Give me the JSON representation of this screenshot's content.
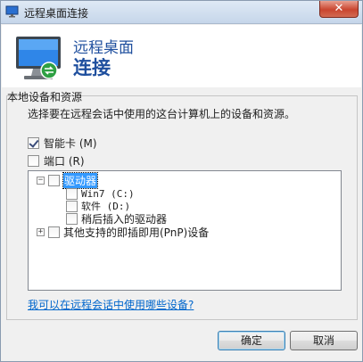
{
  "window": {
    "title": "远程桌面连接",
    "close_label": "✕"
  },
  "header": {
    "line1": "远程桌面",
    "line2": "连接"
  },
  "group": {
    "label": "本地设备和资源",
    "description": "选择要在远程会话中使用的这台计算机上的设备和资源。"
  },
  "options": [
    {
      "label": "智能卡 (M)",
      "checked": true
    },
    {
      "label": "端口 (R)",
      "checked": false
    }
  ],
  "tree": {
    "drives": {
      "label": "驱动器",
      "expander": "−",
      "children": [
        "Win7 (C:)",
        "软件 (D:)",
        "稍后插入的驱动器"
      ]
    },
    "other": {
      "label": "其他支持的即插即用(PnP)设备",
      "expander": "+"
    }
  },
  "link": "我可以在远程会话中使用哪些设备?",
  "buttons": {
    "ok": "确定",
    "cancel": "取消"
  }
}
